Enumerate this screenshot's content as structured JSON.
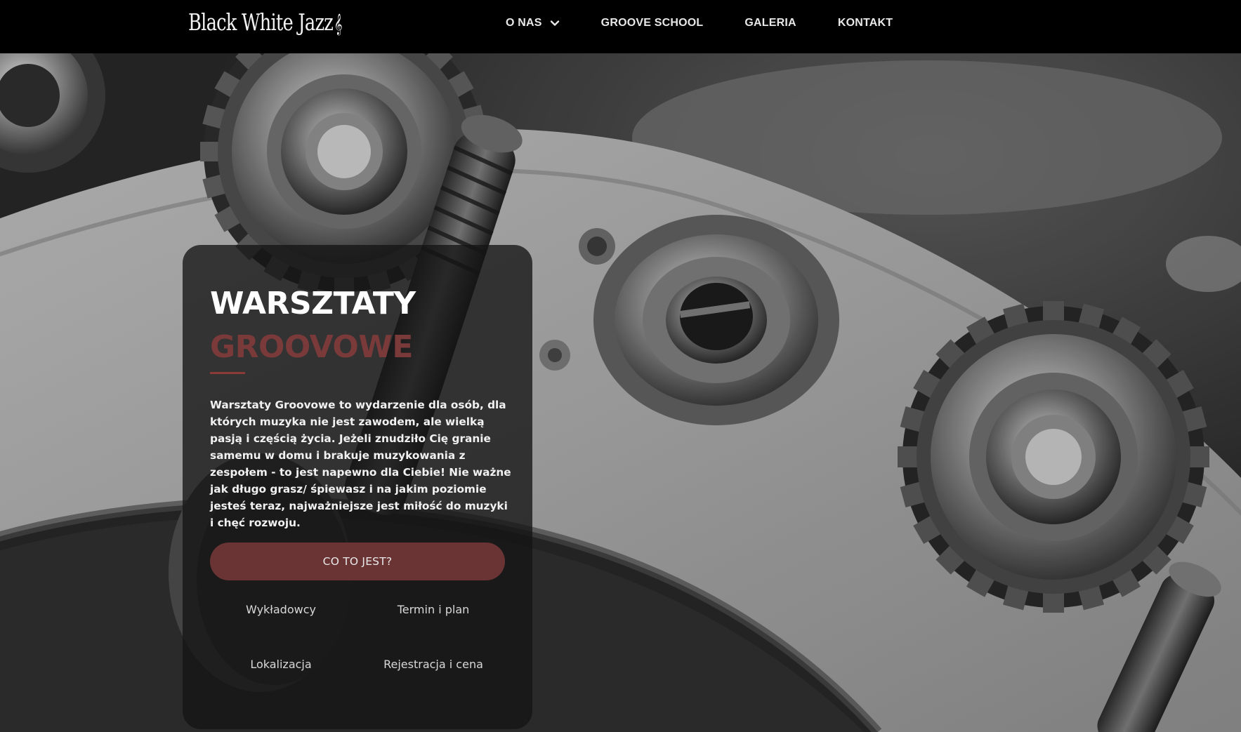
{
  "header": {
    "logo_text": "Black White Jazz",
    "logo_mark": "𝄞",
    "nav": [
      {
        "label": "O NAS",
        "has_dropdown": true
      },
      {
        "label": "GROOVE SCHOOL"
      },
      {
        "label": "GALERIA"
      },
      {
        "label": "KONTAKT"
      }
    ]
  },
  "hero": {
    "background_image": "grayscale close-up of double bass tuning gears"
  },
  "card": {
    "title_line1": "WARSZTATY",
    "title_line2": "GROOVOWE",
    "description": "Warsztaty Groovowe to wydarzenie dla osób, dla których muzyka nie jest zawodem, ale wielką pasją i częścią życia. Jeżeli znudziło Cię granie samemu w domu i brakuje muzykowania z zespołem - to jest napewno dla Ciebie! Nie ważne jak długo grasz/ śpiewasz i na jakim poziomie jesteś teraz, najważniejsze jest miłość do muzyki i chęć rozwoju.",
    "cta_label": "CO TO JEST?",
    "links": {
      "wykladowcy": "Wykładowcy",
      "termin": "Termin i plan",
      "lokalizacja": "Lokalizacja",
      "rejestracja": "Rejestracja i cena"
    }
  },
  "colors": {
    "header_bg": "#000000",
    "accent": "#7a3a3a",
    "cta_bg": "#6b3434",
    "card_bg": "rgba(20,20,20,0.78)"
  }
}
